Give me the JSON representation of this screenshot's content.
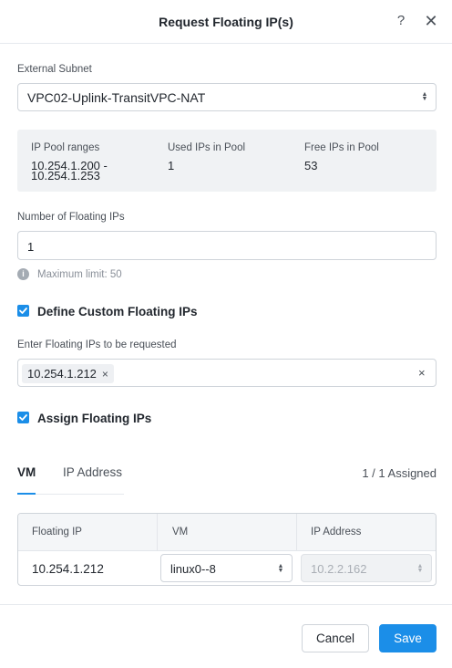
{
  "dialog": {
    "title": "Request Floating IP(s)",
    "help_icon": "question-icon",
    "close_icon": "close-icon"
  },
  "external_subnet": {
    "label": "External Subnet",
    "value": "VPC02-Uplink-TransitVPC-NAT"
  },
  "pool": {
    "ranges_label": "IP Pool ranges",
    "ranges_line1": "10.254.1.200 -",
    "ranges_line2": "10.254.1.253",
    "used_label": "Used IPs in Pool",
    "used_value": "1",
    "free_label": "Free IPs in Pool",
    "free_value": "53"
  },
  "number_field": {
    "label": "Number of Floating IPs",
    "value": "1",
    "hint": "Maximum limit: 50"
  },
  "custom_ips": {
    "checkbox_label": "Define Custom Floating IPs",
    "checked": true,
    "field_label": "Enter Floating IPs to be requested",
    "tags": [
      "10.254.1.212"
    ]
  },
  "assign": {
    "checkbox_label": "Assign Floating IPs",
    "checked": true
  },
  "tabs": {
    "vm": "VM",
    "ip_address": "IP Address",
    "active": "VM",
    "assigned_status": "1 / 1 Assigned"
  },
  "table": {
    "headers": [
      "Floating IP",
      "VM",
      "IP Address"
    ],
    "rows": [
      {
        "floating_ip": "10.254.1.212",
        "vm": "linux0--8",
        "ip_address": "10.2.2.162"
      }
    ]
  },
  "footer": {
    "cancel": "Cancel",
    "save": "Save"
  },
  "colors": {
    "accent": "#1b8ee8",
    "panel": "#f0f2f4",
    "border": "#cfd4da"
  }
}
